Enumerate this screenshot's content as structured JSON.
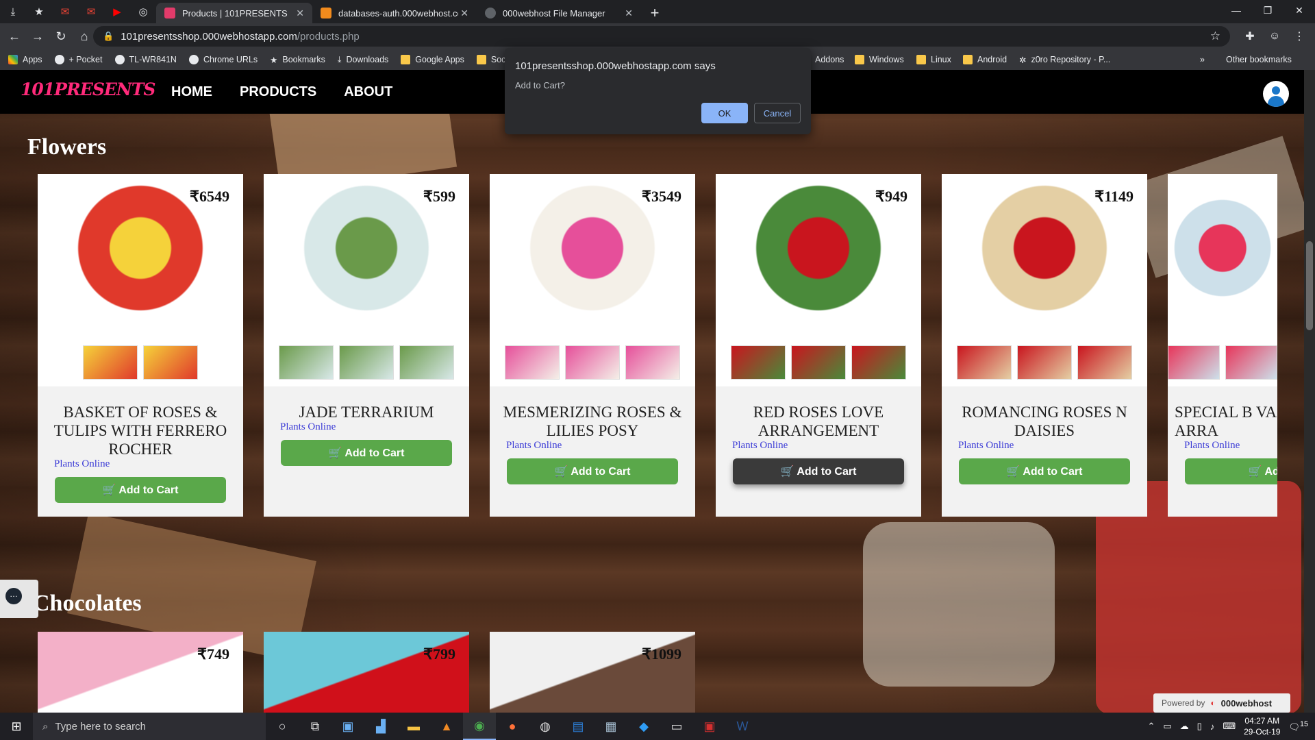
{
  "browser": {
    "tabs": [
      {
        "title": "Products | 101PRESENTS",
        "active": true
      },
      {
        "title": "databases-auth.000webhost.com",
        "active": false
      },
      {
        "title": "000webhost File Manager",
        "active": false
      }
    ],
    "url_host": "101presentsshop.000webhostapp.com",
    "url_path": "/products.php",
    "bookmarks": [
      "Apps",
      "+ Pocket",
      "TL-WR841N",
      "Chrome URLs",
      "Bookmarks",
      "Downloads",
      "Google Apps",
      "Soc",
      "Addons",
      "Windows",
      "Linux",
      "Android",
      "z0ro Repository - P..."
    ],
    "other_bookmarks": "Other bookmarks"
  },
  "site": {
    "logo": "101PRESENTS",
    "nav": [
      "HOME",
      "PRODUCTS",
      "ABOUT"
    ]
  },
  "dialog": {
    "title": "101presentsshop.000webhostapp.com says",
    "message": "Add to Cart?",
    "ok": "OK",
    "cancel": "Cancel"
  },
  "sections": [
    {
      "title": "Flowers",
      "products": [
        {
          "price": "₹6549",
          "name": "BASKET OF ROSES & TULIPS WITH FERRERO ROCHER",
          "category": "Plants Online",
          "button": "Add to Cart",
          "thumbs": 2,
          "colors": [
            "#f5d23a",
            "#e0392b",
            "#4a8a3a"
          ]
        },
        {
          "price": "₹599",
          "name": "JADE TERRARIUM",
          "category": "Plants Online",
          "button": "Add to Cart",
          "thumbs": 3,
          "colors": [
            "#6a9a4a",
            "#d8e8e8",
            "#5a3a28"
          ]
        },
        {
          "price": "₹3549",
          "name": "MESMERIZING ROSES & LILIES POSY",
          "category": "Plants Online",
          "button": "Add to Cart",
          "thumbs": 3,
          "colors": [
            "#e64f9a",
            "#f4f0e8",
            "#3a2a22"
          ]
        },
        {
          "price": "₹949",
          "name": "RED ROSES LOVE ARRANGEMENT",
          "category": "Plants Online",
          "button": "Add to Cart",
          "thumbs": 3,
          "colors": [
            "#c9151e",
            "#4a8a3a",
            "#f2f2f2"
          ]
        },
        {
          "price": "₹1149",
          "name": "ROMANCING ROSES N DAISIES",
          "category": "Plants Online",
          "button": "Add to Cart",
          "thumbs": 3,
          "colors": [
            "#c9151e",
            "#e4cfa4",
            "#ffffff"
          ]
        },
        {
          "price": "",
          "name": "SPECIAL B VASE ARRA",
          "category": "Plants Online",
          "button": "Add t",
          "thumbs": 2,
          "colors": [
            "#e7355a",
            "#cde0ea",
            "#6aa8c9"
          ]
        }
      ]
    },
    {
      "title": "Chocolates",
      "products": [
        {
          "price": "₹749",
          "colors": [
            "#f3b0c8",
            "#ffffff"
          ]
        },
        {
          "price": "₹799",
          "colors": [
            "#6cc8d8",
            "#d0101a"
          ]
        },
        {
          "price": "₹1099",
          "colors": [
            "#f0f0f0",
            "#6a4a3a"
          ]
        }
      ]
    }
  ],
  "powered_by": {
    "label": "Powered by",
    "brand": "000webhost"
  },
  "taskbar": {
    "search_placeholder": "Type here to search",
    "time": "04:27 AM",
    "date": "29-Oct-19",
    "notifications": "15"
  }
}
